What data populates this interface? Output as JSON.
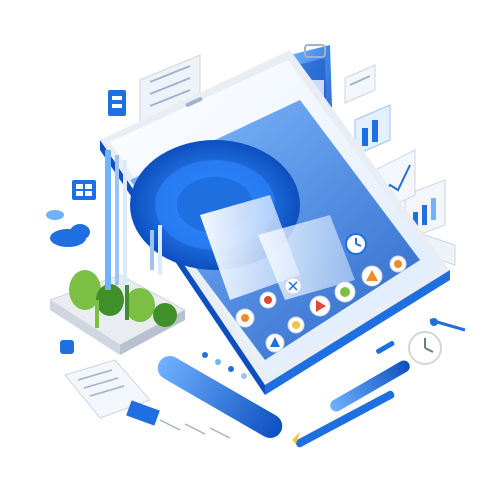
{
  "colors": {
    "background": "#ffffff",
    "primary_blue": "#1f6fe0",
    "deep_blue": "#0d4fbf",
    "light_blue": "#6fb2ff",
    "pale_blue": "#dbeafe",
    "screen_white": "#f7fbff",
    "green": "#7bc043",
    "dark_green": "#3f8f2a",
    "grey": "#cfd6df",
    "orange": "#f08a2a",
    "red": "#e5483b",
    "yellow": "#f5c542"
  },
  "icons": {
    "app_icons": [
      "photos-app-icon",
      "maps-app-icon",
      "play-app-icon",
      "messages-app-icon",
      "gallery-app-icon",
      "music-app-icon",
      "store-app-icon",
      "clock-app-icon"
    ],
    "decor": [
      "tablet-device",
      "phone-screen",
      "bar-chart-panel",
      "line-chart-panel",
      "cloud-icon",
      "analog-clock-icon",
      "pencil-icon",
      "stylus-pen-icon",
      "potted-plants",
      "document-sheet",
      "sliders-panel"
    ]
  }
}
